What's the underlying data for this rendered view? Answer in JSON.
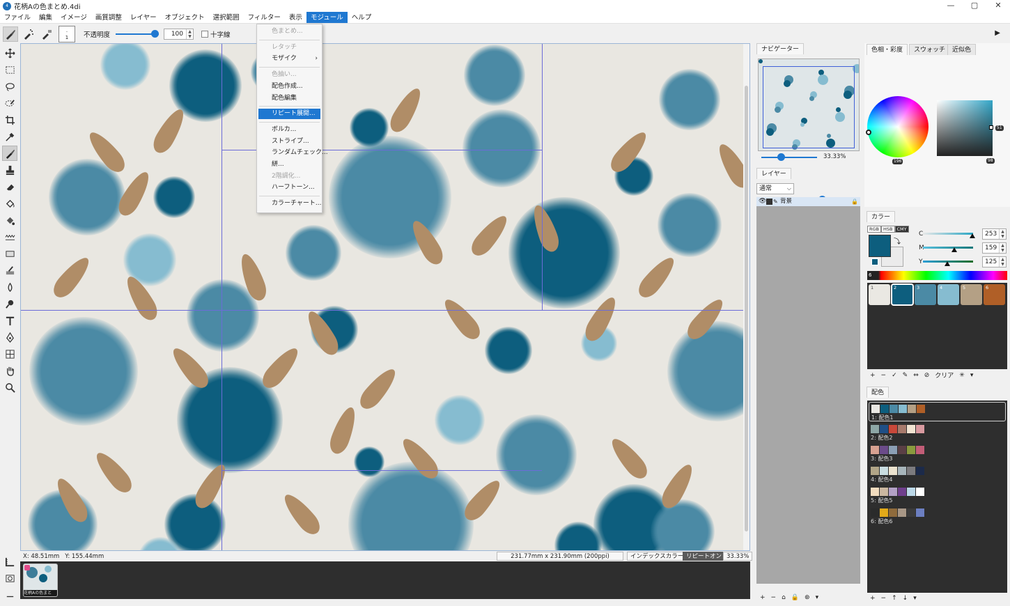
{
  "window": {
    "title": "花柄Aの色まとめ.4di",
    "controls": [
      "—",
      "▢",
      "✕"
    ]
  },
  "menu": [
    "ファイル",
    "編集",
    "イメージ",
    "画質調整",
    "レイヤー",
    "オブジェクト",
    "選択範囲",
    "フィルター",
    "表示",
    "モジュール",
    "ヘルプ"
  ],
  "menu_active_index": 9,
  "toolbar": {
    "brush_size_top": ".",
    "brush_size_bottom": "1",
    "opacity_label": "不透明度",
    "opacity_value": "100",
    "opacity_fraction": 1.0,
    "crosshair_label": "十字線",
    "crosshair_checked": false
  },
  "dropdown": [
    {
      "label": "色まとめ...",
      "disabled": true
    },
    {
      "sep": true
    },
    {
      "label": "レタッチ",
      "disabled": true
    },
    {
      "label": "モザイク",
      "submenu": true
    },
    {
      "sep": true
    },
    {
      "label": "色抽い...",
      "disabled": true
    },
    {
      "label": "配色作成..."
    },
    {
      "label": "配色編集"
    },
    {
      "sep": true
    },
    {
      "label": "リピート展開...",
      "highlighted": true
    },
    {
      "sep": true
    },
    {
      "label": "ボルカ..."
    },
    {
      "label": "ストライプ..."
    },
    {
      "label": "ランダムチェック..."
    },
    {
      "label": "絣..."
    },
    {
      "label": "2階調化...",
      "disabled": true
    },
    {
      "label": "ハーフトーン..."
    },
    {
      "sep": true
    },
    {
      "label": "カラーチャート..."
    }
  ],
  "status": {
    "x": "X:   48.51mm",
    "y": "Y:   155.44mm",
    "size": "231.77mm x 231.90mm (200ppi)",
    "mode": "インデックスカラー",
    "repeat": "リピートオン",
    "zoom": "33.33%"
  },
  "filmstrip": {
    "thumb_label": "花柄Aの色まと"
  },
  "navigator": {
    "tab": "ナビゲーター",
    "zoom": "33.33%",
    "zoom_fraction": 0.33
  },
  "layers": {
    "tab": "レイヤー",
    "blend_mode": "通常",
    "opacity_value": "100",
    "opacity_fraction": 1.0,
    "row_name": "背景"
  },
  "color_tabs": [
    "色相・彩度",
    "スウォッチ",
    "近似色"
  ],
  "hue_badge": "196",
  "sat_badge": "98",
  "val_badge": "51",
  "color_panel": {
    "tab": "カラー",
    "modes": [
      "RGB",
      "HSB",
      "CMY"
    ],
    "channels": [
      {
        "name": "C",
        "value": "253",
        "fraction": 0.99
      },
      {
        "name": "M",
        "value": "159",
        "fraction": 0.62
      },
      {
        "name": "Y",
        "value": "125",
        "fraction": 0.49
      }
    ],
    "fg_color": "#0d5e7e",
    "bg_color": "#ebebeb",
    "spectrum_badge": "6"
  },
  "swatches": [
    {
      "n": "1",
      "color": "#eae8e3"
    },
    {
      "n": "2",
      "color": "#0d5e7e"
    },
    {
      "n": "3",
      "color": "#4b8aa5"
    },
    {
      "n": "4",
      "color": "#86bcd0"
    },
    {
      "n": "5",
      "color": "#b4a085"
    },
    {
      "n": "6",
      "color": "#b05f27"
    }
  ],
  "swatch_tools": [
    "+",
    "−",
    "✓",
    "✎",
    "⇔",
    "⊘",
    "クリア",
    "✳",
    "▾"
  ],
  "haishoku": {
    "tab": "配色",
    "palettes": [
      {
        "label": "1: 配色1",
        "colors": [
          "#eae8e3",
          "#0d5e7e",
          "#4b8aa5",
          "#86bcd0",
          "#b4a085",
          "#b05f27"
        ],
        "selected": true
      },
      {
        "label": "2: 配色2",
        "colors": [
          "#8da6a5",
          "#1f4f86",
          "#c8483a",
          "#a77a6c",
          "#f1e4d2",
          "#d99aa0"
        ]
      },
      {
        "label": "3: 配色3",
        "colors": [
          "#d7a191",
          "#6b4b8a",
          "#8b9fb5",
          "#5a3f45",
          "#8a9a3e",
          "#c25d77"
        ]
      },
      {
        "label": "4: 配色4",
        "colors": [
          "#b1a588",
          "#c9dde1",
          "#ece3cf",
          "#a7b5bb",
          "#7c7b7e",
          "#1c2a4a"
        ]
      },
      {
        "label": "5: 配色5",
        "colors": [
          "#f2dcbf",
          "#cbb7a0",
          "#b3a1c6",
          "#6f3f8c",
          "#bcd8e8",
          "#ffffff"
        ]
      },
      {
        "label": "6: 配色6",
        "colors": [
          "#2a2b2b",
          "#e1a919",
          "#8f6b3c",
          "#a89786",
          "#3b3b3b",
          "#6c7fc1"
        ]
      }
    ]
  },
  "bottom_tools": {
    "layers": [
      "+",
      "−",
      "⌂",
      "🔒",
      "⊛",
      "▾"
    ],
    "palette": [
      "+",
      "−",
      "↑",
      "↓",
      "▾"
    ]
  }
}
